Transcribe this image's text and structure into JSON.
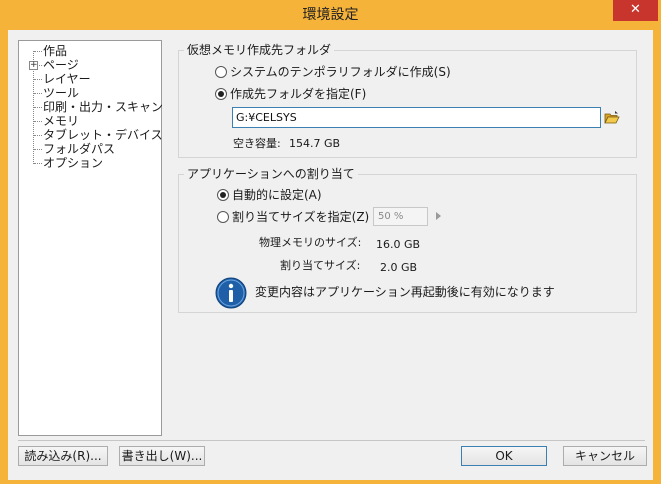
{
  "window": {
    "title": "環境設定",
    "close_label": "✕"
  },
  "tree": {
    "items": [
      {
        "label": "作品"
      },
      {
        "label": "ページ"
      },
      {
        "label": "レイヤー"
      },
      {
        "label": "ツール"
      },
      {
        "label": "印刷・出力・スキャン"
      },
      {
        "label": "メモリ"
      },
      {
        "label": "タブレット・デバイス"
      },
      {
        "label": "フォルダパス"
      },
      {
        "label": "オプション"
      }
    ],
    "expander": "+"
  },
  "vm_group": {
    "legend": "仮想メモリ作成先フォルダ",
    "radio_temp": "システムのテンポラリフォルダに作成(S)",
    "radio_specify": "作成先フォルダを指定(F)",
    "path_value": "G:¥CELSYS",
    "free_label": "空き容量:",
    "free_value": "154.7 GB"
  },
  "alloc_group": {
    "legend": "アプリケーションへの割り当て",
    "radio_auto": "自動的に設定(A)",
    "radio_size": "割り当てサイズを指定(Z)",
    "size_value": "50 %",
    "physical_label": "物理メモリのサイズ:",
    "physical_value": "16.0 GB",
    "assigned_label": "割り当てサイズ:",
    "assigned_value": "2.0 GB",
    "notice": "変更内容はアプリケーション再起動後に有効になります"
  },
  "buttons": {
    "import": "読み込み(R)...",
    "export": "書き出し(W)...",
    "ok": "OK",
    "cancel": "キャンセル"
  },
  "colors": {
    "frame": "#f5b33a",
    "close": "#c7352c",
    "info": "#1e5fa8"
  },
  "icons": {
    "folder": "folder-open-icon",
    "info": "info-icon"
  }
}
